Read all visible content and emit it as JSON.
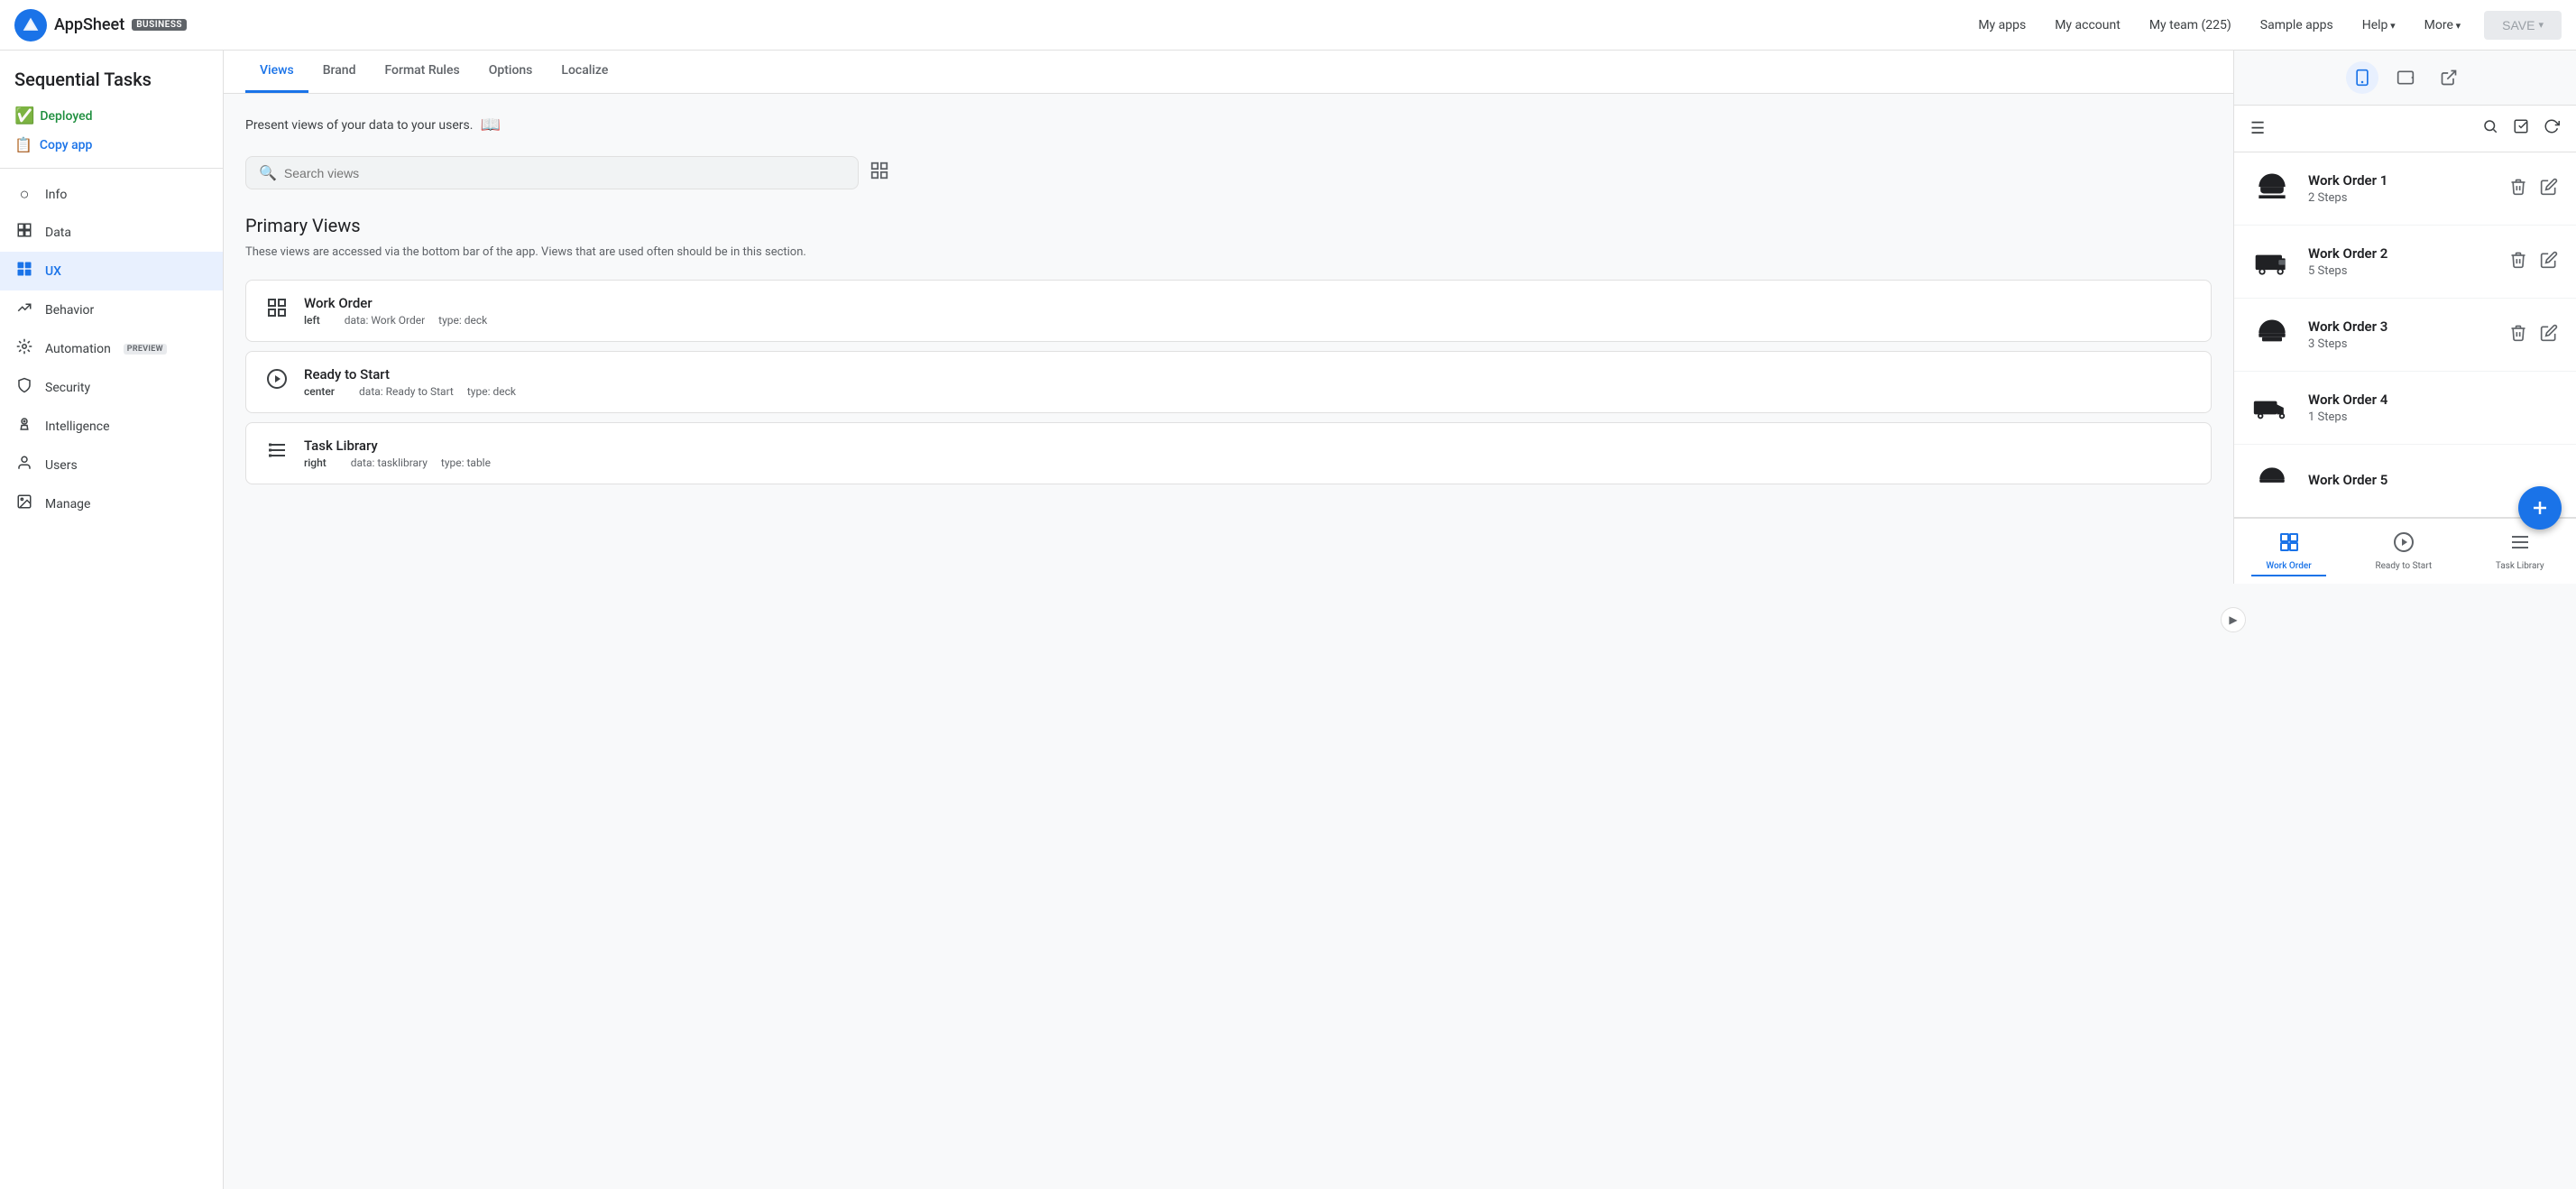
{
  "app": {
    "name": "AppSheet",
    "badge": "BUSINESS",
    "title": "Sequential Tasks"
  },
  "nav": {
    "links": [
      "My apps",
      "My account",
      "My team (225)",
      "Sample apps"
    ],
    "dropdown_links": [
      "Help",
      "More"
    ],
    "save_label": "SAVE"
  },
  "sidebar": {
    "deployed_label": "Deployed",
    "copy_app_label": "Copy app",
    "items": [
      {
        "id": "info",
        "label": "Info",
        "icon": "ℹ"
      },
      {
        "id": "data",
        "label": "Data",
        "icon": "▦"
      },
      {
        "id": "ux",
        "label": "UX",
        "icon": "⊞",
        "active": true
      },
      {
        "id": "behavior",
        "label": "Behavior",
        "icon": "↗"
      },
      {
        "id": "automation",
        "label": "Automation",
        "icon": "⚙",
        "preview": "PREVIEW"
      },
      {
        "id": "security",
        "label": "Security",
        "icon": "🛡"
      },
      {
        "id": "intelligence",
        "label": "Intelligence",
        "icon": "💡"
      },
      {
        "id": "users",
        "label": "Users",
        "icon": "👤"
      },
      {
        "id": "manage",
        "label": "Manage",
        "icon": "📷"
      }
    ]
  },
  "tabs": [
    {
      "id": "views",
      "label": "Views",
      "active": true
    },
    {
      "id": "brand",
      "label": "Brand"
    },
    {
      "id": "format-rules",
      "label": "Format Rules"
    },
    {
      "id": "options",
      "label": "Options"
    },
    {
      "id": "localize",
      "label": "Localize"
    }
  ],
  "content": {
    "description": "Present views of your data to your users.",
    "search_placeholder": "Search views",
    "primary_views_title": "Primary Views",
    "primary_views_description": "These views are accessed via the bottom bar of the app. Views that are used often should be in this section.",
    "views": [
      {
        "id": "work-order",
        "name": "Work Order",
        "position": "left",
        "data": "Work Order",
        "type": "deck",
        "icon": "grid"
      },
      {
        "id": "ready-to-start",
        "name": "Ready to Start",
        "position": "center",
        "data": "Ready to Start",
        "type": "deck",
        "icon": "play"
      },
      {
        "id": "task-library",
        "name": "Task Library",
        "position": "right",
        "data": "tasklibrary",
        "type": "table",
        "icon": "list"
      }
    ]
  },
  "preview": {
    "work_orders": [
      {
        "id": 1,
        "name": "Work Order 1",
        "steps": "2 Steps",
        "icon_type": "helmet"
      },
      {
        "id": 2,
        "name": "Work Order 2",
        "steps": "5 Steps",
        "icon_type": "van"
      },
      {
        "id": 3,
        "name": "Work Order 3",
        "steps": "3 Steps",
        "icon_type": "helmet2"
      },
      {
        "id": 4,
        "name": "Work Order 4",
        "steps": "1 Steps",
        "icon_type": "truck"
      },
      {
        "id": 5,
        "name": "Work Order 5",
        "steps": "",
        "icon_type": "helmet3"
      }
    ],
    "bottom_tabs": [
      {
        "id": "work-order",
        "label": "Work Order",
        "active": true
      },
      {
        "id": "ready-to-start",
        "label": "Ready to Start"
      },
      {
        "id": "task-library",
        "label": "Task Library"
      }
    ],
    "fab_label": "+"
  }
}
